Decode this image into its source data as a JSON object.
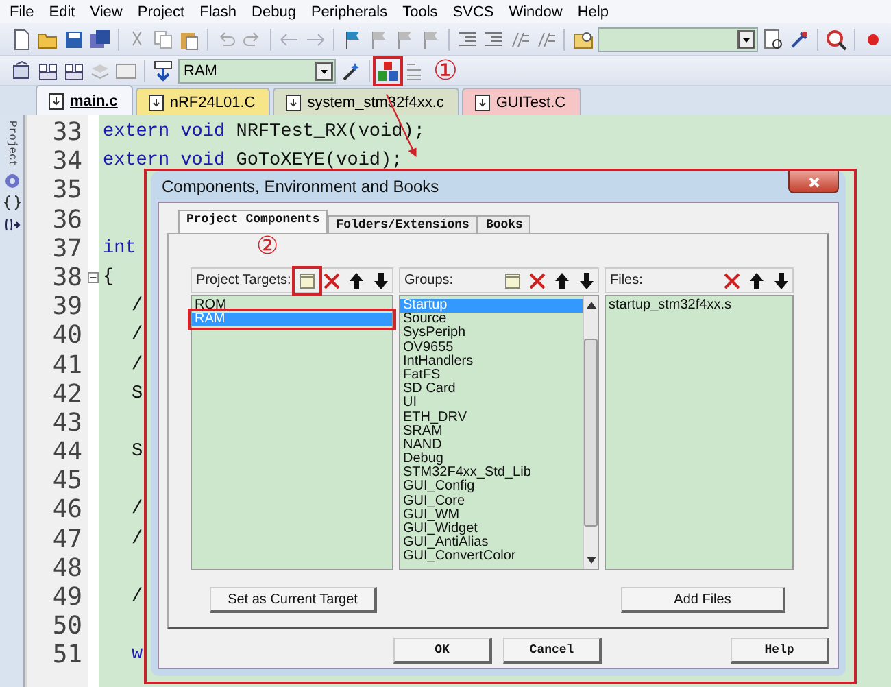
{
  "menu": [
    {
      "label": "File"
    },
    {
      "label": "Edit"
    },
    {
      "label": "View"
    },
    {
      "label": "Project"
    },
    {
      "label": "Flash"
    },
    {
      "label": "Debug"
    },
    {
      "label": "Peripherals"
    },
    {
      "label": "Tools"
    },
    {
      "label": "SVCS"
    },
    {
      "label": "Window"
    },
    {
      "label": "Help"
    }
  ],
  "target_select": {
    "value": "RAM"
  },
  "side_panel": {
    "title": "Project"
  },
  "file_tabs": [
    {
      "label": "main.c",
      "selected": true,
      "color": "#f4f6fb"
    },
    {
      "label": "nRF24L01.C",
      "selected": false,
      "color": "#f7e58a"
    },
    {
      "label": "system_stm32f4xx.c",
      "selected": false,
      "color": "#d9e0c8"
    },
    {
      "label": "GUITest.C",
      "selected": false,
      "color": "#f6c6c6"
    }
  ],
  "code_lines": [
    {
      "number": "33",
      "kind": "plain",
      "tokens": [
        {
          "kind": "keyword",
          "text": "extern void "
        },
        {
          "kind": "plain",
          "text": "NRFTest_RX(void);"
        }
      ]
    },
    {
      "number": "34",
      "kind": "plain",
      "tokens": [
        {
          "kind": "keyword",
          "text": "extern void "
        },
        {
          "kind": "plain",
          "text": "GoToXEYE(void);"
        }
      ]
    },
    {
      "number": "35",
      "kind": "plain"
    },
    {
      "number": "36",
      "kind": "plain"
    },
    {
      "number": "37",
      "kind": "plain",
      "tokens": [
        {
          "kind": "keyword",
          "text": "int"
        }
      ]
    },
    {
      "number": "38",
      "kind": "fold",
      "tokens": [
        {
          "kind": "plain",
          "text": "{"
        }
      ]
    },
    {
      "number": "39",
      "kind": "indented",
      "tokens": [
        {
          "kind": "plain",
          "text": "/"
        }
      ]
    },
    {
      "number": "40",
      "kind": "indented",
      "tokens": [
        {
          "kind": "plain",
          "text": "/"
        }
      ]
    },
    {
      "number": "41",
      "kind": "indented",
      "tokens": [
        {
          "kind": "plain",
          "text": "/"
        }
      ]
    },
    {
      "number": "42",
      "kind": "indented",
      "tokens": [
        {
          "kind": "plain",
          "text": "S"
        }
      ]
    },
    {
      "number": "43",
      "kind": "plain"
    },
    {
      "number": "44",
      "kind": "indented",
      "tokens": [
        {
          "kind": "plain",
          "text": "S"
        }
      ]
    },
    {
      "number": "45",
      "kind": "plain"
    },
    {
      "number": "46",
      "kind": "indented",
      "tokens": [
        {
          "kind": "plain",
          "text": "/"
        }
      ]
    },
    {
      "number": "47",
      "kind": "indented",
      "tokens": [
        {
          "kind": "plain",
          "text": "/"
        }
      ]
    },
    {
      "number": "48",
      "kind": "plain"
    },
    {
      "number": "49",
      "kind": "indented",
      "tokens": [
        {
          "kind": "plain",
          "text": "/"
        }
      ]
    },
    {
      "number": "50",
      "kind": "plain"
    },
    {
      "number": "51",
      "kind": "indented",
      "tokens": [
        {
          "kind": "keyword",
          "text": "w"
        }
      ]
    }
  ],
  "dialog": {
    "title": "Components, Environment and Books",
    "tabs": [
      {
        "label": "Project Components",
        "selected": true
      },
      {
        "label": "Folders/Extensions",
        "selected": false
      },
      {
        "label": "Books",
        "selected": false
      }
    ],
    "panels": [
      {
        "label": "Project Targets:",
        "can_add": true,
        "scrollbar": false,
        "items": [
          {
            "label": "ROM",
            "selected": false
          },
          {
            "label": "RAM",
            "selected": true
          }
        ]
      },
      {
        "label": "Groups:",
        "can_add": true,
        "scrollbar": true,
        "items": [
          {
            "label": "Startup",
            "selected": true
          },
          {
            "label": "Source",
            "selected": false
          },
          {
            "label": "SysPeriph",
            "selected": false
          },
          {
            "label": "OV9655",
            "selected": false
          },
          {
            "label": "IntHandlers",
            "selected": false
          },
          {
            "label": "FatFS",
            "selected": false
          },
          {
            "label": "SD Card",
            "selected": false
          },
          {
            "label": "UI",
            "selected": false
          },
          {
            "label": "ETH_DRV",
            "selected": false
          },
          {
            "label": "SRAM",
            "selected": false
          },
          {
            "label": "NAND",
            "selected": false
          },
          {
            "label": "Debug",
            "selected": false
          },
          {
            "label": "STM32F4xx_Std_Lib",
            "selected": false
          },
          {
            "label": "GUI_Config",
            "selected": false
          },
          {
            "label": "GUI_Core",
            "selected": false
          },
          {
            "label": "GUI_WM",
            "selected": false
          },
          {
            "label": "GUI_Widget",
            "selected": false
          },
          {
            "label": "GUI_AntiAlias",
            "selected": false
          },
          {
            "label": "GUI_ConvertColor",
            "selected": false
          }
        ]
      },
      {
        "label": "Files:",
        "can_add": false,
        "scrollbar": false,
        "items": [
          {
            "label": "startup_stm32f4xx.s",
            "selected": false
          }
        ]
      }
    ],
    "panel_buttons": [
      {
        "label": "Set as Current Target"
      },
      {
        "label": "Add Files"
      }
    ],
    "buttons": [
      {
        "label": "OK"
      },
      {
        "label": "Cancel"
      },
      {
        "label": "Help"
      }
    ]
  },
  "annotations": [
    {
      "label": "①"
    },
    {
      "label": "②"
    }
  ]
}
